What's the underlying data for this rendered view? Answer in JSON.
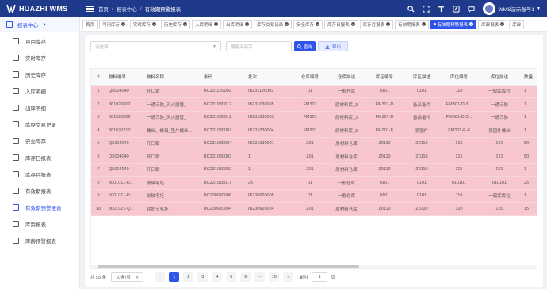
{
  "header": {
    "brand": "HUAZHI WMS",
    "breadcrumb": [
      "首页",
      "报表中心",
      "有效期预警报表"
    ],
    "user_name": "WMS演示账号1",
    "icons": [
      "search-icon",
      "fullscreen-icon",
      "font-size-icon",
      "translate-icon",
      "message-icon"
    ]
  },
  "sidebar": {
    "group_label": "报表中心",
    "items": [
      {
        "label": "可用库存",
        "icon": "home-icon"
      },
      {
        "label": "实时库存",
        "icon": "home-icon"
      },
      {
        "label": "历史库存",
        "icon": "home-icon"
      },
      {
        "label": "入库明细",
        "icon": "inbound-icon"
      },
      {
        "label": "出库明细",
        "icon": "outbound-icon"
      },
      {
        "label": "库存交易记录",
        "icon": "transaction-icon"
      },
      {
        "label": "安全库存",
        "icon": "safety-icon"
      },
      {
        "label": "库存日报表",
        "icon": "calendar-icon"
      },
      {
        "label": "库存月报表",
        "icon": "calendar-icon"
      },
      {
        "label": "有效期报表",
        "icon": "calendar-icon"
      },
      {
        "label": "有效期预警报表",
        "icon": "calendar-icon",
        "active": true
      },
      {
        "label": "库龄报表",
        "icon": "clock-icon"
      },
      {
        "label": "库龄预警报表",
        "icon": "warning-icon"
      }
    ]
  },
  "tabs": [
    {
      "label": "首页",
      "closable": false
    },
    {
      "label": "可用库存",
      "closable": true
    },
    {
      "label": "实时库存",
      "closable": true
    },
    {
      "label": "历史库存",
      "closable": true
    },
    {
      "label": "入库明细",
      "closable": true
    },
    {
      "label": "出库明细",
      "closable": true
    },
    {
      "label": "库存交易记录",
      "closable": true
    },
    {
      "label": "安全库存",
      "closable": true
    },
    {
      "label": "库存日报表",
      "closable": true
    },
    {
      "label": "库存月报表",
      "closable": true
    },
    {
      "label": "有效期报表",
      "closable": true
    },
    {
      "label": "有效期预警报表",
      "closable": true,
      "active": true
    },
    {
      "label": "库龄报表",
      "closable": true
    },
    {
      "label": "库龄",
      "closable": false
    }
  ],
  "filters": {
    "select_placeholder": "请选择",
    "keyword_placeholder": "搜索关键字",
    "query_label": "查询",
    "export_label": "导出"
  },
  "table": {
    "columns": [
      "#",
      "物料编号",
      "物料名称",
      "条码",
      "批次",
      "仓库编号",
      "仓库描述",
      "库区编号",
      "库区描述",
      "库位编号",
      "库位描述",
      "数量"
    ],
    "rows": [
      [
        "1",
        "Q5004040",
        "开口销",
        "BC231120002",
        "IB231120002",
        "01",
        "一般仓库",
        "0101",
        "0101",
        "110",
        "一般库库位",
        "1"
      ],
      [
        "2",
        "361020002",
        "一通三防_灭火器管_",
        "BC231030012",
        "IB231030005",
        "FM301",
        "原材料库_3",
        "FM301-D",
        "备品备件",
        "FM301-D-3...",
        "一通三防",
        "1"
      ],
      [
        "3",
        "361020002",
        "一通三防_灭火器管_",
        "BC231030011",
        "IB231030005",
        "FM301",
        "原材料库_3",
        "FM301-D",
        "备品备件",
        "FM301-D-3...",
        "一通三防",
        "1"
      ],
      [
        "4",
        "381020212",
        "螺丝、螺母_垫片螺丝...",
        "BC231030007",
        "IB231030004",
        "FM301",
        "原材料库_3",
        "FM301-E",
        "紧固件",
        "FM301-E-8",
        "紧固件螺丝",
        "1"
      ],
      [
        "5",
        "Q5004040",
        "开口销",
        "BC231030004",
        "IB231030001",
        "Z01",
        "原材料仓库",
        "Z0110",
        "Z0110",
        "121",
        "121",
        "50"
      ],
      [
        "6",
        "Q5004040",
        "开口销",
        "BC231030003",
        "1",
        "Z01",
        "原材料仓库",
        "Z0110",
        "Z0110",
        "121",
        "121",
        "50"
      ],
      [
        "7",
        "Q5004040",
        "开口销",
        "BC231030002",
        "1",
        "Z01",
        "原材料仓库",
        "Z0110",
        "Z0110",
        "121",
        "121",
        "1"
      ],
      [
        "8",
        "3001011-D...",
        "前轴毛坯",
        "BC231018017",
        "25",
        "01",
        "一般仓库",
        "0101",
        "0101",
        "010101",
        "010101",
        "25"
      ],
      [
        "9",
        "5001011-D...",
        "前轴毛坯",
        "BC230920006",
        "IB230920005",
        "01",
        "一般仓库",
        "0101",
        "0101",
        "110",
        "一般库库位",
        "1"
      ],
      [
        "10",
        "3001021-Q...",
        "转向节毛坯",
        "BC230920004",
        "IB230920004",
        "Z01",
        "原材料仓库",
        "Z0110",
        "Z0110",
        "120",
        "120",
        "15"
      ]
    ]
  },
  "pagination": {
    "total": "共 95 条",
    "page_size": "10条/页",
    "prev": "<",
    "pages": [
      "1",
      "2",
      "3",
      "4",
      "5",
      "6",
      "···",
      "10"
    ],
    "current": "1",
    "next": ">",
    "goto_label": "前往",
    "goto_value": "1",
    "goto_suffix": "页"
  }
}
